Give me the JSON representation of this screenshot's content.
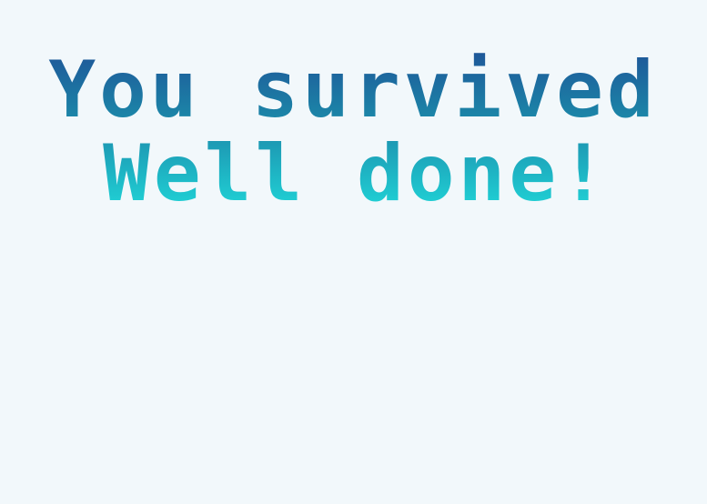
{
  "game_over": {
    "line1": "You survived",
    "line2": "Well done!"
  },
  "colors": {
    "background": "#f2f8fb",
    "gradient_top": "#1e4f96",
    "gradient_mid": "#1c86a8",
    "gradient_bottom": "#20d6d8"
  }
}
